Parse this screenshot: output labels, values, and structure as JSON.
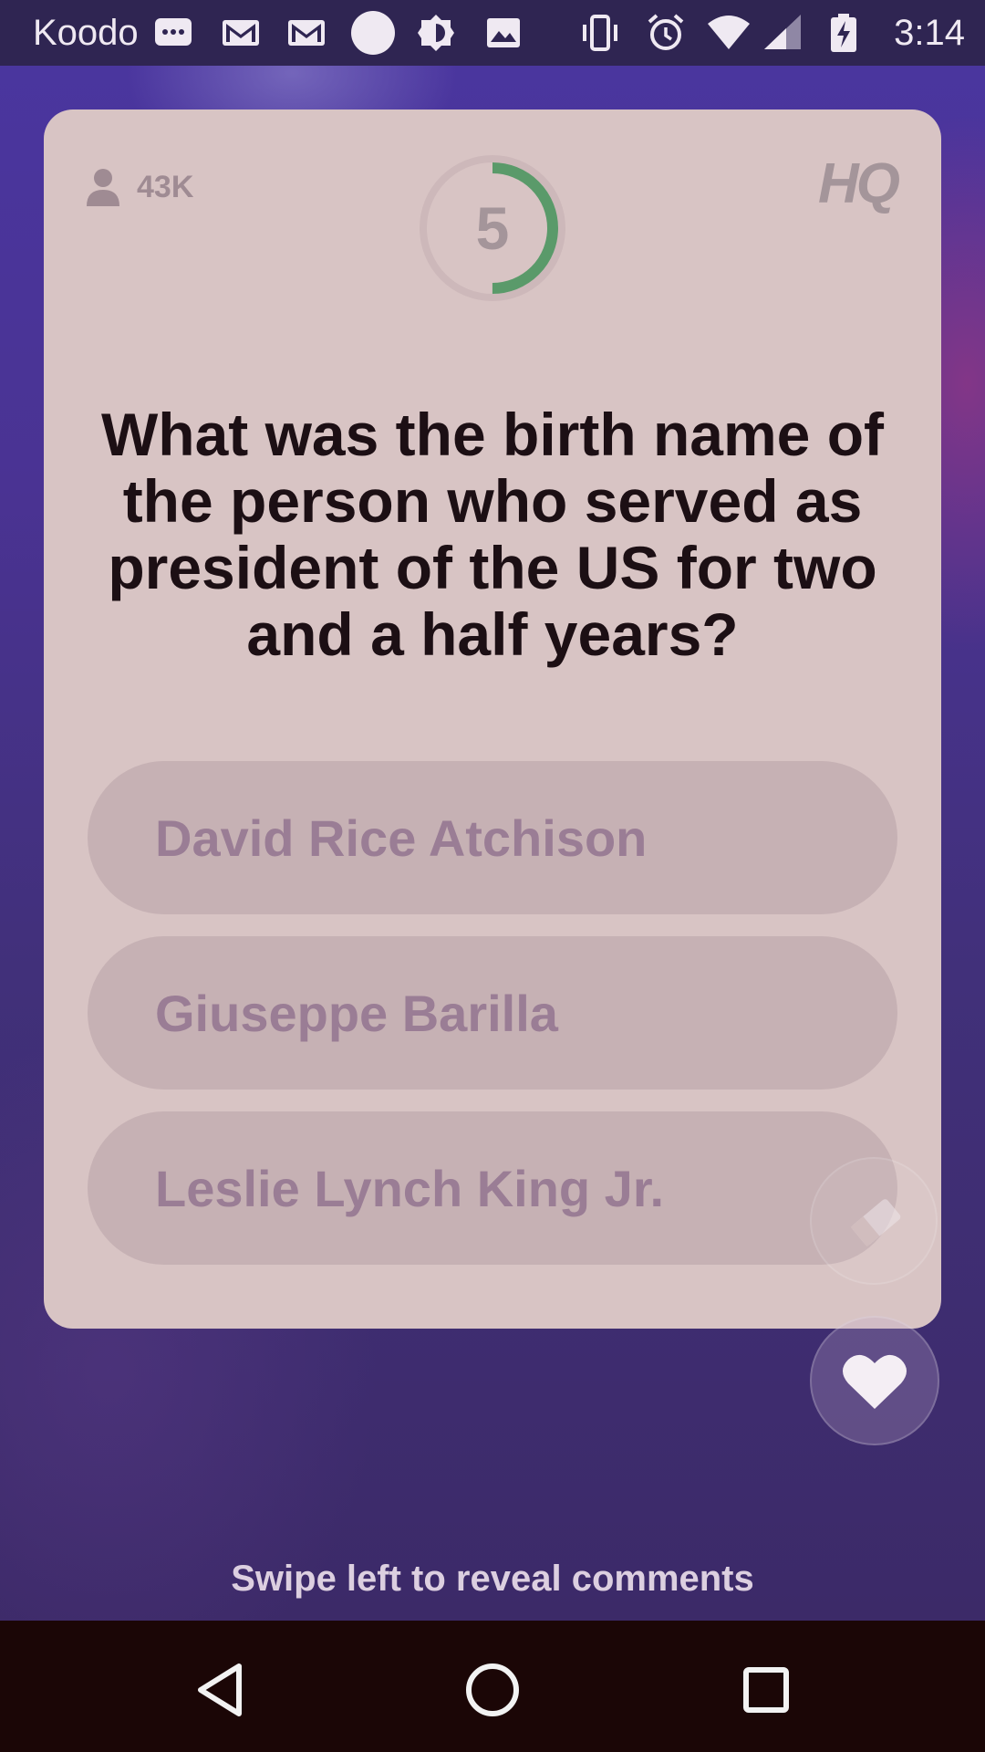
{
  "status_bar": {
    "carrier": "Koodo",
    "time": "3:14",
    "icons": [
      "message-icon",
      "gmail-icon",
      "gmail-icon",
      "circle-icon",
      "brightness-icon",
      "image-icon",
      "vibrate-icon",
      "alarm-icon",
      "wifi-icon",
      "signal-icon",
      "battery-charging-icon"
    ]
  },
  "card": {
    "viewer_count": "43K",
    "timer_value": "5",
    "timer_progress": 0.5,
    "logo_text": "HQ",
    "question": "What was the birth name of the person who served as president of the US for two and a half years?",
    "answers": [
      {
        "label": "David Rice Atchison"
      },
      {
        "label": "Giuseppe Barilla"
      },
      {
        "label": "Leslie Lynch King Jr."
      }
    ]
  },
  "footer": {
    "swipe_hint": "Swipe left to reveal comments"
  },
  "nav": {
    "buttons": [
      "back-icon",
      "home-icon",
      "recents-icon"
    ]
  },
  "colors": {
    "card_bg": "#d8c4c4",
    "answer_bg": "#c6b1b4",
    "timer_ring": "#5a9a6a",
    "question_text": "#1c0f14",
    "answer_text": "#9a7d95"
  }
}
